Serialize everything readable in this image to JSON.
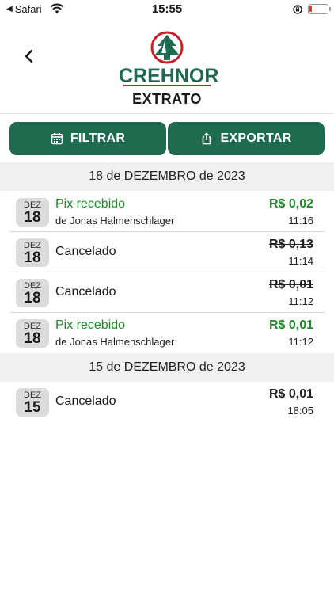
{
  "status_bar": {
    "back_app": "Safari",
    "time": "15:55"
  },
  "header": {
    "brand": "CREHNOR",
    "title": "EXTRATO"
  },
  "actions": {
    "filter_label": "FILTRAR",
    "export_label": "EXPORTAR"
  },
  "colors": {
    "brand_green": "#1f6b4f",
    "positive_green": "#1e8a28",
    "brand_red": "#c8202b"
  },
  "icons": {
    "back": "chevron-left-icon",
    "filter": "calendar-icon",
    "export": "share-icon"
  },
  "groups": [
    {
      "date": "18 de DEZEMBRO de 2023",
      "transactions": [
        {
          "month": "DEZ",
          "day": "18",
          "title": "Pix recebido",
          "subtitle": "de Jonas Halmenschlager",
          "amount": "R$ 0,02",
          "time": "11:16",
          "status": "received"
        },
        {
          "month": "DEZ",
          "day": "18",
          "title": "Cancelado",
          "amount": "R$ 0,13",
          "time": "11:14",
          "status": "canceled"
        },
        {
          "month": "DEZ",
          "day": "18",
          "title": "Cancelado",
          "amount": "R$ 0,01",
          "time": "11:12",
          "status": "canceled"
        },
        {
          "month": "DEZ",
          "day": "18",
          "title": "Pix recebido",
          "subtitle": "de Jonas Halmenschlager",
          "amount": "R$ 0,01",
          "time": "11:12",
          "status": "received"
        }
      ]
    },
    {
      "date": "15 de DEZEMBRO de 2023",
      "transactions": [
        {
          "month": "DEZ",
          "day": "15",
          "title": "Cancelado",
          "amount": "R$ 0,01",
          "time": "18:05",
          "status": "canceled"
        }
      ]
    }
  ]
}
